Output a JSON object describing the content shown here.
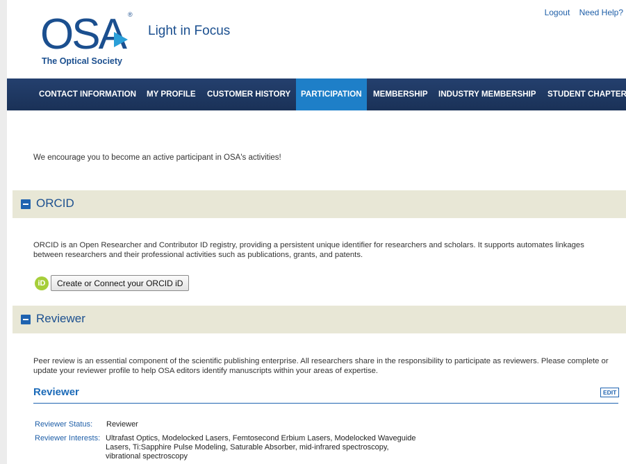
{
  "header": {
    "logo_text": "OSA",
    "logo_reg": "®",
    "logo_subtitle": "The Optical Society",
    "tagline": "Light in Focus",
    "logout": "Logout",
    "help": "Need Help?"
  },
  "nav": {
    "items": [
      "CONTACT INFORMATION",
      "MY PROFILE",
      "CUSTOMER HISTORY",
      "PARTICIPATION",
      "MEMBERSHIP",
      "INDUSTRY MEMBERSHIP",
      "STUDENT CHAPTER"
    ],
    "active": "PARTICIPATION"
  },
  "intro": "We encourage you to become an active participant in OSA's activities!",
  "orcid": {
    "title": "ORCID",
    "description": "ORCID is an Open Researcher and Contributor ID registry, providing a persistent unique identifier for researchers and scholars. It supports automates linkages between researchers and their professional activities such as publications, grants, and patents.",
    "icon_text": "iD",
    "button": "Create or Connect your ORCID iD"
  },
  "reviewer": {
    "title": "Reviewer",
    "description": "Peer review is an essential component of the scientific publishing enterprise. All researchers share in the responsibility to participate as reviewers. Please complete or update your reviewer profile to help OSA editors identify manuscripts within your areas of expertise.",
    "subheading": "Reviewer",
    "edit": "EDIT",
    "status_label": "Reviewer Status:",
    "status_value": "Reviewer",
    "interests_label": "Reviewer Interests:",
    "interests_value": "Ultrafast Optics, Modelocked Lasers, Femtosecond Erbium Lasers, Modelocked Waveguide Lasers, Ti:Sapphire Pulse Modeling, Saturable Absorber, mid-infrared spectroscopy, vibrational spectroscopy"
  },
  "colors": {
    "brand_blue": "#1b4f8f",
    "nav_bg": "#1a3157",
    "nav_active": "#1e7fc8",
    "section_bg": "#e8e7d6",
    "orcid_green": "#a6ce39"
  }
}
